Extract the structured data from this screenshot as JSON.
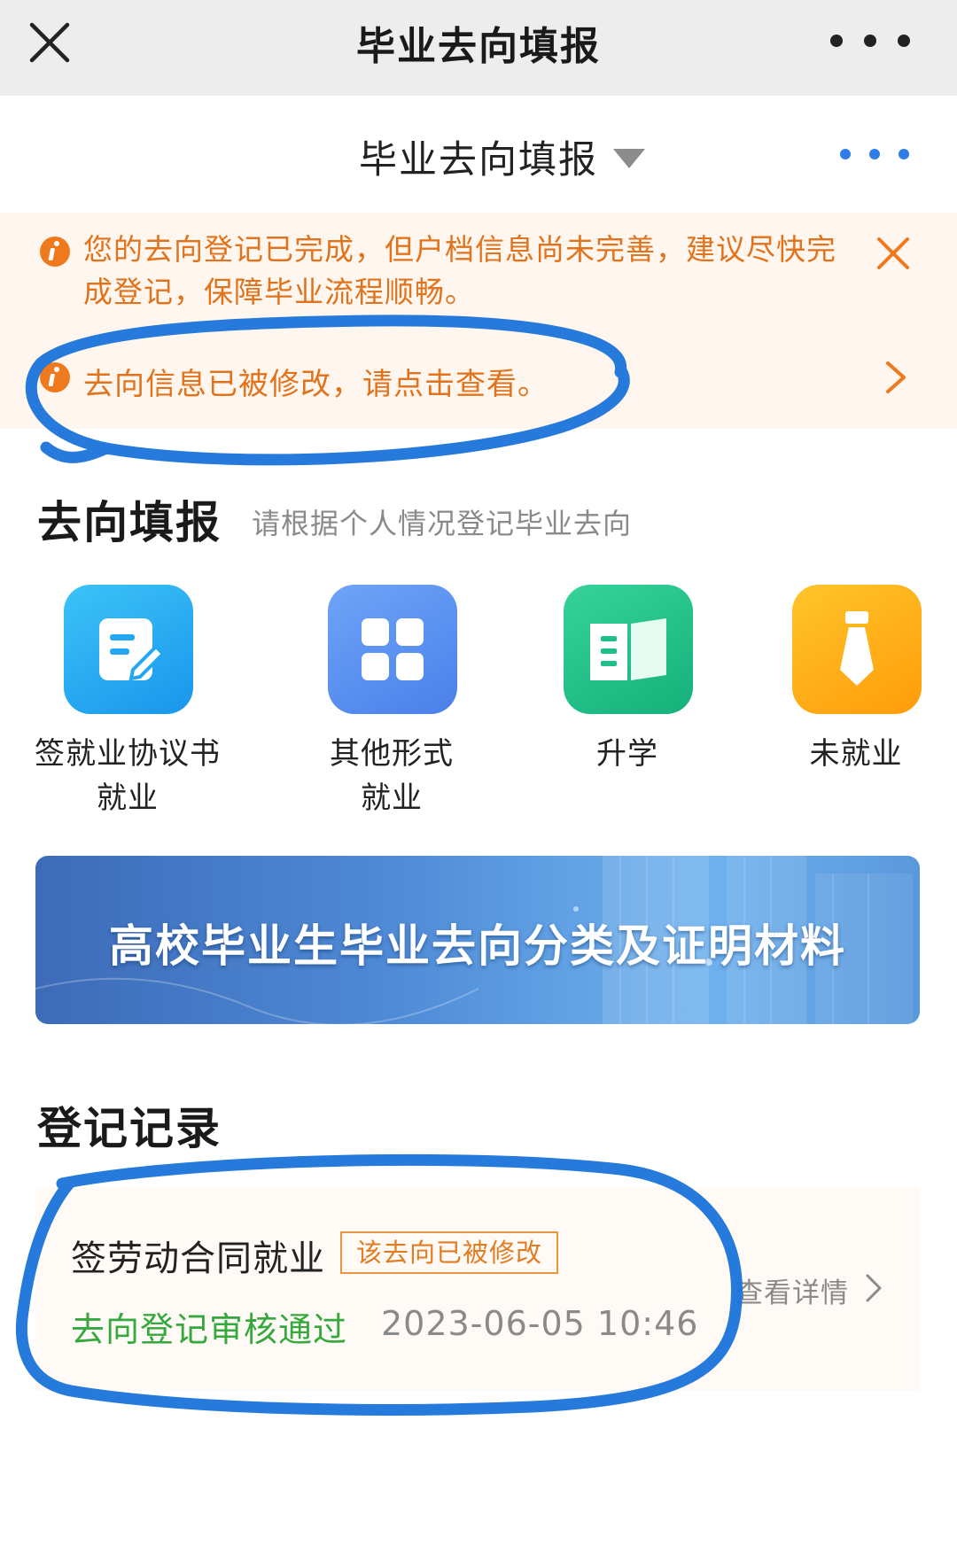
{
  "topbar": {
    "title": "毕业去向填报"
  },
  "subheader": {
    "title": "毕业去向填报"
  },
  "notices": {
    "message_1": "您的去向登记已完成，但户档信息尚未完善，建议尽快完成登记，保障毕业流程顺畅。",
    "message_2": "去向信息已被修改，请点击查看。"
  },
  "fill_section": {
    "title": "去向填报",
    "subtitle": "请根据个人情况登记毕业去向",
    "options": [
      {
        "line1": "签就业协议书",
        "line2": "就业",
        "icon": "pen-document-icon",
        "color": "#22a7f0"
      },
      {
        "line1": "其他形式",
        "line2": "就业",
        "icon": "grid-icon",
        "color": "#5b8ff2"
      },
      {
        "line1": "升学",
        "line2": "",
        "icon": "book-icon",
        "color": "#1fbf8a"
      },
      {
        "line1": "未就业",
        "line2": "",
        "icon": "tie-icon",
        "color": "#ffab14"
      }
    ]
  },
  "banner": {
    "text": "高校毕业生毕业去向分类及证明材料"
  },
  "records_section": {
    "title": "登记记录",
    "records": [
      {
        "type": "签劳动合同就业",
        "badge": "该去向已被修改",
        "status": "去向登记审核通过",
        "time": "2023-06-05 10:46",
        "detail_link": "查看详情"
      }
    ]
  },
  "colors": {
    "notice_text": "#e0731b",
    "notice_bg": "#fff6ef",
    "status_ok": "#35a93d",
    "badge": "#e07d22",
    "annotation": "#1a73d9"
  }
}
